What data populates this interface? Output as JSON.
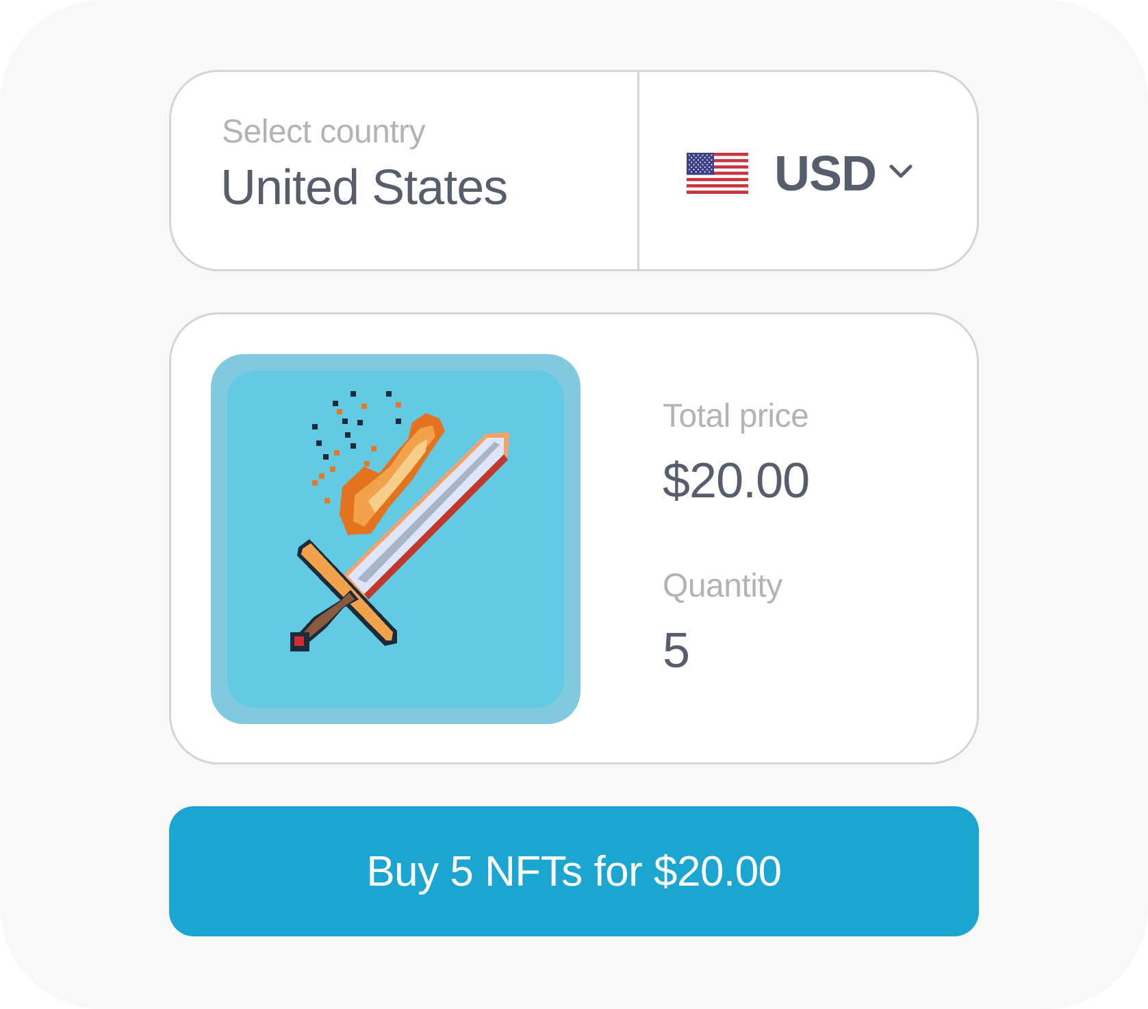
{
  "country_select": {
    "label": "Select country",
    "value": "United States"
  },
  "currency_select": {
    "flag": "us-flag-icon",
    "code": "USD",
    "chevron": "chevron-down-icon"
  },
  "item": {
    "image": "flaming-sword-nft",
    "total_price_label": "Total price",
    "total_price_value": "$20.00",
    "quantity_label": "Quantity",
    "quantity_value": "5"
  },
  "buy_button": {
    "label": "Buy 5 NFTs for $20.00"
  },
  "colors": {
    "accent": "#1aa6d1",
    "text_primary": "#575e6b",
    "text_muted": "#b3b3b3",
    "card_border": "#d4d4d4",
    "nft_background": "#62cae3"
  }
}
